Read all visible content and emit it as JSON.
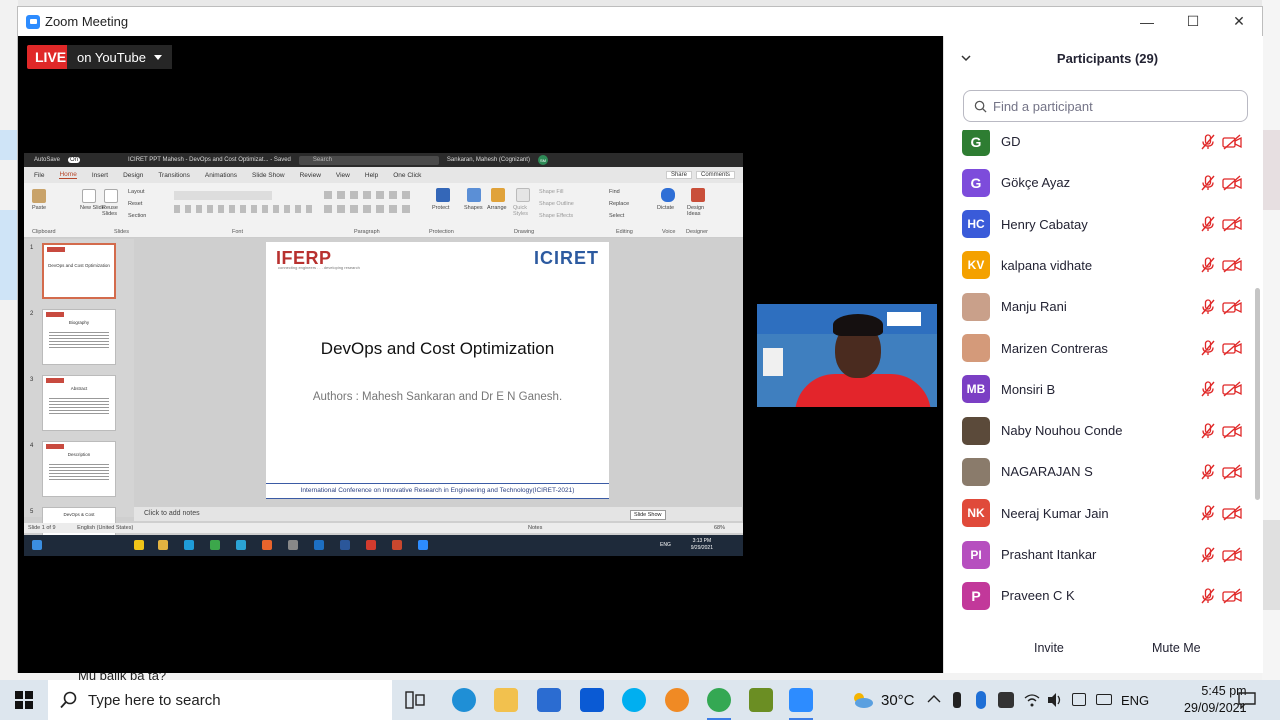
{
  "window": {
    "title": "Zoom Meeting",
    "controls": {
      "minimize": "—",
      "maximize": "☐",
      "close": "✕"
    }
  },
  "live": {
    "badge": "LIVE",
    "destination": "on YouTube"
  },
  "shared_screen": {
    "ppt_titlebar": "ICIRET PPT Mahesh - DevOps and Cost Optimizat... - Saved",
    "autosave": "AutoSave",
    "autosave_state": "On",
    "search_placeholder": "Search",
    "user": "Sankaran, Mahesh (Cognizant)",
    "user_initials": "SM",
    "menu": [
      "File",
      "Home",
      "Insert",
      "Design",
      "Transitions",
      "Animations",
      "Slide Show",
      "Review",
      "View",
      "Help",
      "One Click"
    ],
    "share_label": "Share",
    "comments_label": "Comments",
    "ribbon_groups": [
      "Clipboard",
      "Slides",
      "Font",
      "Paragraph",
      "Protection",
      "Drawing",
      "Editing",
      "Voice",
      "Designer"
    ],
    "ribbon_buttons": [
      "Paste",
      "New Slide",
      "Reuse Slides",
      "Layout",
      "Reset",
      "Section",
      "Protect",
      "Shapes",
      "Arrange",
      "Quick Styles",
      "Shape Fill",
      "Shape Outline",
      "Shape Effects",
      "Find",
      "Replace",
      "Select",
      "Dictate",
      "Design Ideas"
    ],
    "thumbnails": [
      {
        "num": "1",
        "title": "DevOps and Cost Optimization"
      },
      {
        "num": "2",
        "title": "Biography"
      },
      {
        "num": "3",
        "title": "Abstract"
      },
      {
        "num": "4",
        "title": "Description"
      },
      {
        "num": "5",
        "title": "DevOps & Cost"
      }
    ],
    "slide": {
      "logo_left": "IFERP",
      "logo_left_sub": "connecting engineers . . . developing research",
      "logo_right": "ICIRET",
      "title": "DevOps and Cost Optimization",
      "authors": "Authors : Mahesh Sankaran and Dr E N Ganesh.",
      "footer": "International Conference on Innovative Research in Engineering and Technology(ICIRET-2021)"
    },
    "notes": "Click to add notes",
    "status_left": "Slide 1 of 9",
    "status_lang": "English (United States)",
    "status_notes": "Notes",
    "zoom_pct": "68%",
    "tooltip": "Slide Show",
    "inner_clock_time": "3:13 PM",
    "inner_clock_date": "9/29/2021",
    "inner_lang": "ENG"
  },
  "participants": {
    "title": "Participants (29)",
    "search_placeholder": "Find a participant",
    "list": [
      {
        "initials": "G",
        "name": "GD",
        "color": "#2e7d32",
        "photo": false
      },
      {
        "initials": "G",
        "name": "Gökçe Ayaz",
        "color": "#7d4cdb",
        "photo": false
      },
      {
        "initials": "HC",
        "name": "Henry Cabatay",
        "color": "#3a5bd9",
        "photo": false
      },
      {
        "initials": "KV",
        "name": "kalpana vidhate",
        "color": "#f4a100",
        "photo": false
      },
      {
        "initials": "",
        "name": "Manju Rani",
        "color": "#c9a08a",
        "photo": true
      },
      {
        "initials": "",
        "name": "Marizen Contreras",
        "color": "#d49a7a",
        "photo": true
      },
      {
        "initials": "MB",
        "name": "Monsiri B",
        "color": "#7b3fc4",
        "photo": false
      },
      {
        "initials": "",
        "name": "Naby Nouhou Conde",
        "color": "#5b4a3a",
        "photo": true
      },
      {
        "initials": "",
        "name": "NAGARAJAN S",
        "color": "#8a7b6b",
        "photo": true
      },
      {
        "initials": "NK",
        "name": "Neeraj Kumar Jain",
        "color": "#e04a3a",
        "photo": false
      },
      {
        "initials": "PI",
        "name": "Prashant Itankar",
        "color": "#b64fbf",
        "photo": false
      },
      {
        "initials": "P",
        "name": "Praveen C K",
        "color": "#c2389a",
        "photo": false
      }
    ],
    "invite_label": "Invite",
    "mute_me_label": "Mute Me"
  },
  "behind_window_text": "Mu balik pa ta?",
  "taskbar": {
    "search_placeholder": "Type here to search",
    "weather": "30°C",
    "lang": "ENG",
    "time": "5:45 pm",
    "date": "29/09/2021"
  },
  "colors": {
    "live_red": "#e02828",
    "zoom_blue": "#2d8cff",
    "muted_red": "#e02828"
  }
}
